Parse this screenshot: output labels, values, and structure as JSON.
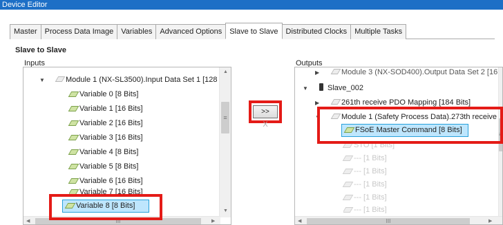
{
  "window": {
    "title": "Device Editor"
  },
  "tabs": [
    "Master",
    "Process Data Image",
    "Variables",
    "Advanced Options",
    "Slave to Slave",
    "Distributed Clocks",
    "Multiple Tasks"
  ],
  "active_tab": "Slave to Slave",
  "section_title": "Slave to Slave",
  "inputs": {
    "label": "Inputs",
    "module": "Module 1 (NX-SL3500).Input Data Set 1 [128",
    "variables": [
      "Variable 0 [8 Bits]",
      "Variable 1 [16 Bits]",
      "Variable 2 [16 Bits]",
      "Variable 3 [16 Bits]",
      "Variable 4 [8 Bits]",
      "Variable 5 [8 Bits]",
      "Variable 6 [16 Bits]",
      "Variable 7 [16 Bits]",
      "Variable 8 [8 Bits]"
    ]
  },
  "buttons": {
    "map": ">>",
    "unmap": "X"
  },
  "outputs": {
    "label": "Outputs",
    "top_partial": "Module 3 (NX-SOD400).Output Data Set 2 [16",
    "slave": "Slave_002",
    "pdo": "261th receive PDO Mapping [184 Bits]",
    "module": "Module 1 (Safety Process Data).273th receive",
    "selected": "FSoE Master Command [8 Bits]",
    "grey_items": [
      "STO [1 Bits]",
      "--- [1 Bits]",
      "--- [1 Bits]",
      "--- [1 Bits]",
      "--- [1 Bits]",
      "--- [1 Bits]"
    ]
  },
  "scrollbar_glyph": "≡",
  "hscroll_glyph": "III"
}
